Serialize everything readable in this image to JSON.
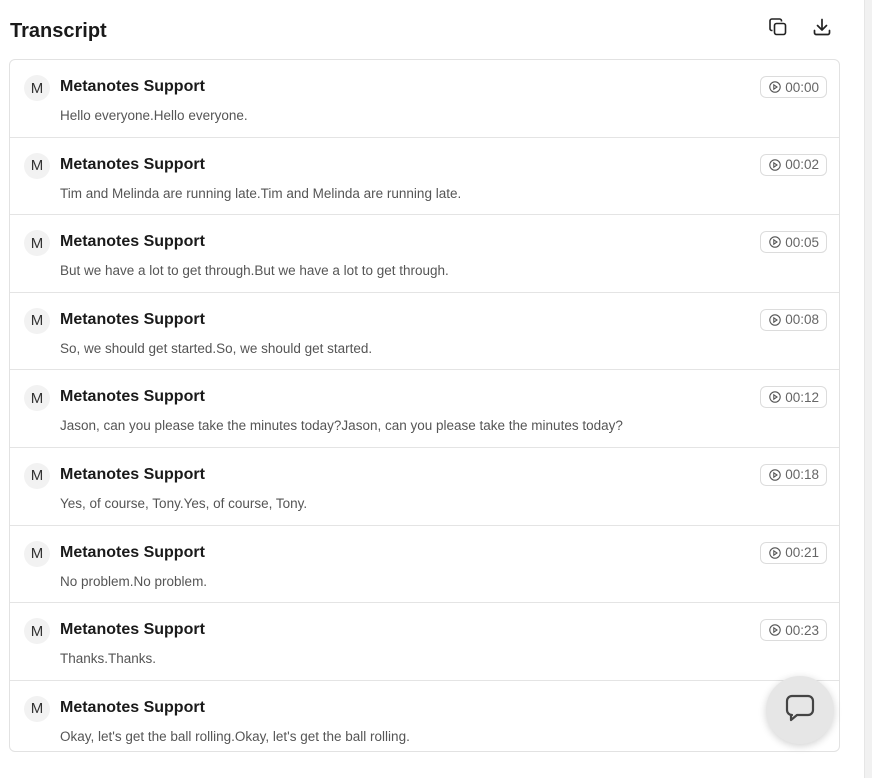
{
  "transcript": {
    "title": "Transcript",
    "icons": {
      "copy": "copy-icon",
      "download": "download-icon",
      "play": "play-circle-icon",
      "chat": "chat-bubble-icon"
    },
    "entries": [
      {
        "avatar": "M",
        "speaker": "Metanotes Support",
        "timestamp": "00:00",
        "text": "Hello everyone.Hello everyone."
      },
      {
        "avatar": "M",
        "speaker": "Metanotes Support",
        "timestamp": "00:02",
        "text": "Tim and Melinda are running late.Tim and Melinda are running late."
      },
      {
        "avatar": "M",
        "speaker": "Metanotes Support",
        "timestamp": "00:05",
        "text": "But we have a lot to get through.But we have a lot to get through."
      },
      {
        "avatar": "M",
        "speaker": "Metanotes Support",
        "timestamp": "00:08",
        "text": "So, we should get started.So, we should get started."
      },
      {
        "avatar": "M",
        "speaker": "Metanotes Support",
        "timestamp": "00:12",
        "text": "Jason, can you please take the minutes today?Jason, can you please take the minutes today?"
      },
      {
        "avatar": "M",
        "speaker": "Metanotes Support",
        "timestamp": "00:18",
        "text": "Yes, of course, Tony.Yes, of course, Tony."
      },
      {
        "avatar": "M",
        "speaker": "Metanotes Support",
        "timestamp": "00:21",
        "text": "No problem.No problem."
      },
      {
        "avatar": "M",
        "speaker": "Metanotes Support",
        "timestamp": "00:23",
        "text": "Thanks.Thanks."
      },
      {
        "avatar": "M",
        "speaker": "Metanotes Support",
        "timestamp": "",
        "text": "Okay, let's get the ball rolling.Okay, let's get the ball rolling."
      }
    ]
  }
}
